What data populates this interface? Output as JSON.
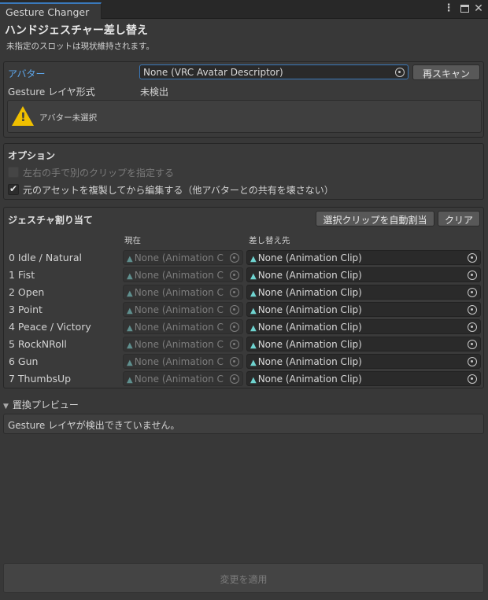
{
  "window": {
    "tab_title": "Gesture Changer",
    "menu_icon": "kebab-menu-icon",
    "maximize_icon": "maximize-icon",
    "close_icon": "close-icon"
  },
  "header": {
    "title": "ハンドジェスチャー差し替え",
    "subtitle": "未指定のスロットは現状維持されます。"
  },
  "avatar_section": {
    "avatar_label": "アバター",
    "avatar_field_value": "None (VRC Avatar Descriptor)",
    "rescan_button": "再スキャン",
    "gesture_layer_label": "Gesture レイヤ形式",
    "gesture_layer_value": "未検出",
    "warning_icon": "warning-icon",
    "warning_message": "アバター未選択"
  },
  "options_section": {
    "heading": "オプション",
    "separate_hands_label": "左右の手で別のクリップを指定する",
    "separate_hands_checked": false,
    "separate_hands_enabled": false,
    "duplicate_asset_label": "元のアセットを複製してから編集する（他アバターとの共有を壊さない）",
    "duplicate_asset_checked": true
  },
  "assignment_section": {
    "heading": "ジェスチャ割り当て",
    "auto_assign_button": "選択クリップを自動割当",
    "clear_button": "クリア",
    "col_current": "現在",
    "col_replacement": "差し替え先",
    "rows": [
      {
        "label": "0  Idle / Natural",
        "current": "None (Animation C",
        "replacement": "None (Animation Clip)"
      },
      {
        "label": "1  Fist",
        "current": "None (Animation C",
        "replacement": "None (Animation Clip)"
      },
      {
        "label": "2  Open",
        "current": "None (Animation C",
        "replacement": "None (Animation Clip)"
      },
      {
        "label": "3  Point",
        "current": "None (Animation C",
        "replacement": "None (Animation Clip)"
      },
      {
        "label": "4  Peace / Victory",
        "current": "None (Animation C",
        "replacement": "None (Animation Clip)"
      },
      {
        "label": "5  RockNRoll",
        "current": "None (Animation C",
        "replacement": "None (Animation Clip)"
      },
      {
        "label": "6  Gun",
        "current": "None (Animation C",
        "replacement": "None (Animation Clip)"
      },
      {
        "label": "7  ThumbsUp",
        "current": "None (Animation C",
        "replacement": "None (Animation Clip)"
      }
    ]
  },
  "preview_section": {
    "foldout_label": "置換プレビュー",
    "foldout_expanded": true,
    "message": "Gesture レイヤが検出できていません。"
  },
  "footer": {
    "apply_button": "変更を適用",
    "apply_enabled": false
  },
  "colors": {
    "accent": "#3a79bb",
    "link": "#5da6ea",
    "warning": "#f0c000",
    "background": "#383838"
  }
}
